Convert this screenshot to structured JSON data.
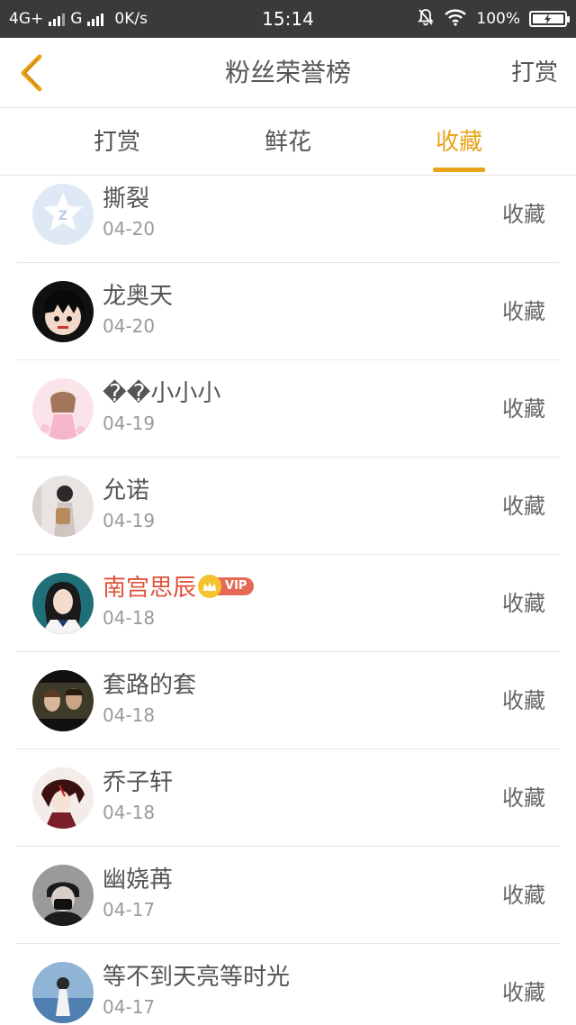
{
  "status_bar": {
    "network1": "4G+",
    "network2": "G",
    "speed": "0K/s",
    "time": "15:14",
    "battery": "100%"
  },
  "nav": {
    "title": "粉丝荣誉榜",
    "right_action": "打赏"
  },
  "tabs": [
    {
      "label": "打赏",
      "active": false
    },
    {
      "label": "鲜花",
      "active": false
    },
    {
      "label": "收藏",
      "active": true
    }
  ],
  "accent_color": "#e8a31a",
  "vip_badge": "VIP",
  "items": [
    {
      "name": "撕裂",
      "date": "04-20",
      "action": "收藏",
      "avatar": "default-q-logo"
    },
    {
      "name": "龙奥天",
      "date": "04-20",
      "action": "收藏",
      "avatar": "cartoon-boy"
    },
    {
      "name": "��小小小",
      "date": "04-19",
      "action": "收藏",
      "avatar": "anime-girl-pink"
    },
    {
      "name": "允诺",
      "date": "04-19",
      "action": "收藏",
      "avatar": "girl-backpack"
    },
    {
      "name": "南宫思辰",
      "date": "04-18",
      "action": "收藏",
      "avatar": "girl-portrait",
      "vip": true
    },
    {
      "name": "套路的套",
      "date": "04-18",
      "action": "收藏",
      "avatar": "film-scene"
    },
    {
      "name": "乔子轩",
      "date": "04-18",
      "action": "收藏",
      "avatar": "anime-boy"
    },
    {
      "name": "幽娆苒",
      "date": "04-17",
      "action": "收藏",
      "avatar": "masked-person"
    },
    {
      "name": "等不到天亮等时光",
      "date": "04-17",
      "action": "收藏",
      "avatar": "girl-seaside"
    }
  ]
}
